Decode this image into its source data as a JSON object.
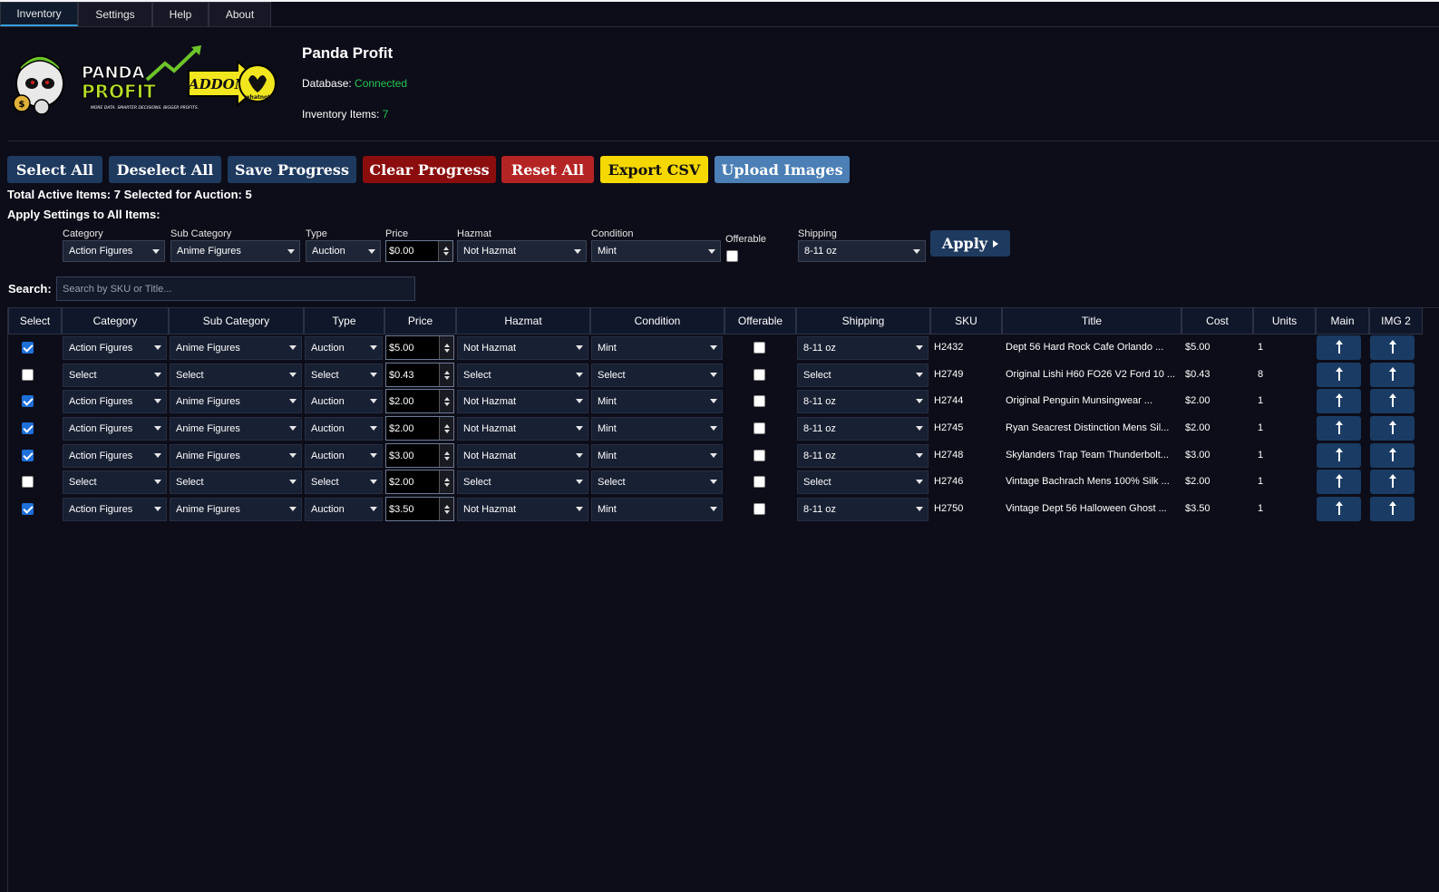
{
  "tabs": [
    "Inventory",
    "Settings",
    "Help",
    "About"
  ],
  "app": {
    "title": "Panda Profit",
    "db_label": "Database:",
    "db_status": "Connected",
    "inv_label": "Inventory Items:",
    "inv_count": "7"
  },
  "toolbar": {
    "select_all": "Select All",
    "deselect_all": "Deselect All",
    "save_progress": "Save Progress",
    "clear_progress": "Clear Progress",
    "reset_all": "Reset All",
    "export_csv": "Export CSV",
    "upload_images": "Upload Images"
  },
  "summary": "Total Active Items: 7  Selected for Auction: 5",
  "apply_settings": {
    "title": "Apply Settings to All Items:",
    "labels": {
      "category": "Category",
      "sub_category": "Sub Category",
      "type": "Type",
      "price": "Price",
      "hazmat": "Hazmat",
      "condition": "Condition",
      "offerable": "Offerable",
      "shipping": "Shipping"
    },
    "values": {
      "category": "Action Figures",
      "sub_category": "Anime Figures",
      "type": "Auction",
      "price": "$0.00",
      "hazmat": "Not Hazmat",
      "condition": "Mint",
      "shipping": "8-11 oz"
    },
    "apply_label": "Apply"
  },
  "search": {
    "label": "Search:",
    "placeholder": "Search by SKU or Title..."
  },
  "table": {
    "headers": {
      "select": "Select",
      "category": "Category",
      "sub_category": "Sub Category",
      "type": "Type",
      "price": "Price",
      "hazmat": "Hazmat",
      "condition": "Condition",
      "offerable": "Offerable",
      "shipping": "Shipping",
      "sku": "SKU",
      "title": "Title",
      "cost": "Cost",
      "units": "Units",
      "main": "Main",
      "img2": "IMG 2"
    },
    "rows": [
      {
        "selected": true,
        "category": "Action Figures",
        "sub_category": "Anime Figures",
        "type": "Auction",
        "price": "$5.00",
        "hazmat": "Not Hazmat",
        "condition": "Mint",
        "offerable": false,
        "shipping": "8-11 oz",
        "sku": "H2432",
        "title": "Dept 56 Hard Rock Cafe Orlando ...",
        "cost": "$5.00",
        "units": "1"
      },
      {
        "selected": false,
        "category": "Select",
        "sub_category": "Select",
        "type": "Select",
        "price": "$0.43",
        "hazmat": "Select",
        "condition": "Select",
        "offerable": false,
        "shipping": "Select",
        "sku": "H2749",
        "title": "Original Lishi H60 FO26 V2 Ford 10 ...",
        "cost": "$0.43",
        "units": "8"
      },
      {
        "selected": true,
        "category": "Action Figures",
        "sub_category": "Anime Figures",
        "type": "Auction",
        "price": "$2.00",
        "hazmat": "Not Hazmat",
        "condition": "Mint",
        "offerable": false,
        "shipping": "8-11 oz",
        "sku": "H2744",
        "title": "Original Penguin Munsingwear ...",
        "cost": "$2.00",
        "units": "1"
      },
      {
        "selected": true,
        "category": "Action Figures",
        "sub_category": "Anime Figures",
        "type": "Auction",
        "price": "$2.00",
        "hazmat": "Not Hazmat",
        "condition": "Mint",
        "offerable": false,
        "shipping": "8-11 oz",
        "sku": "H2745",
        "title": "Ryan Seacrest Distinction Mens Sil...",
        "cost": "$2.00",
        "units": "1"
      },
      {
        "selected": true,
        "category": "Action Figures",
        "sub_category": "Anime Figures",
        "type": "Auction",
        "price": "$3.00",
        "hazmat": "Not Hazmat",
        "condition": "Mint",
        "offerable": false,
        "shipping": "8-11 oz",
        "sku": "H2748",
        "title": "Skylanders Trap Team Thunderbolt...",
        "cost": "$3.00",
        "units": "1"
      },
      {
        "selected": false,
        "category": "Select",
        "sub_category": "Select",
        "type": "Select",
        "price": "$2.00",
        "hazmat": "Select",
        "condition": "Select",
        "offerable": false,
        "shipping": "Select",
        "sku": "H2746",
        "title": "Vintage Bachrach Mens 100% Silk ...",
        "cost": "$2.00",
        "units": "1"
      },
      {
        "selected": true,
        "category": "Action Figures",
        "sub_category": "Anime Figures",
        "type": "Auction",
        "price": "$3.50",
        "hazmat": "Not Hazmat",
        "condition": "Mint",
        "offerable": false,
        "shipping": "8-11 oz",
        "sku": "H2750",
        "title": "Vintage Dept 56 Halloween Ghost ...",
        "cost": "$3.50",
        "units": "1"
      }
    ]
  },
  "logo": {
    "line1": "PANDA",
    "line2": "PROFIT",
    "addon": "ADDON",
    "tagline": "MORE DATA. SMARTER DECISIONS. BIGGER PROFITS.",
    "brand": "whatnot"
  },
  "colors": {
    "background": "#0d0d19",
    "connected": "#23c552",
    "btn_navy": "#1f3a5f",
    "btn_clear": "#8b0d0d",
    "btn_reset": "#b52424",
    "btn_export": "#f5d800",
    "btn_upload": "#4b7fb5"
  }
}
